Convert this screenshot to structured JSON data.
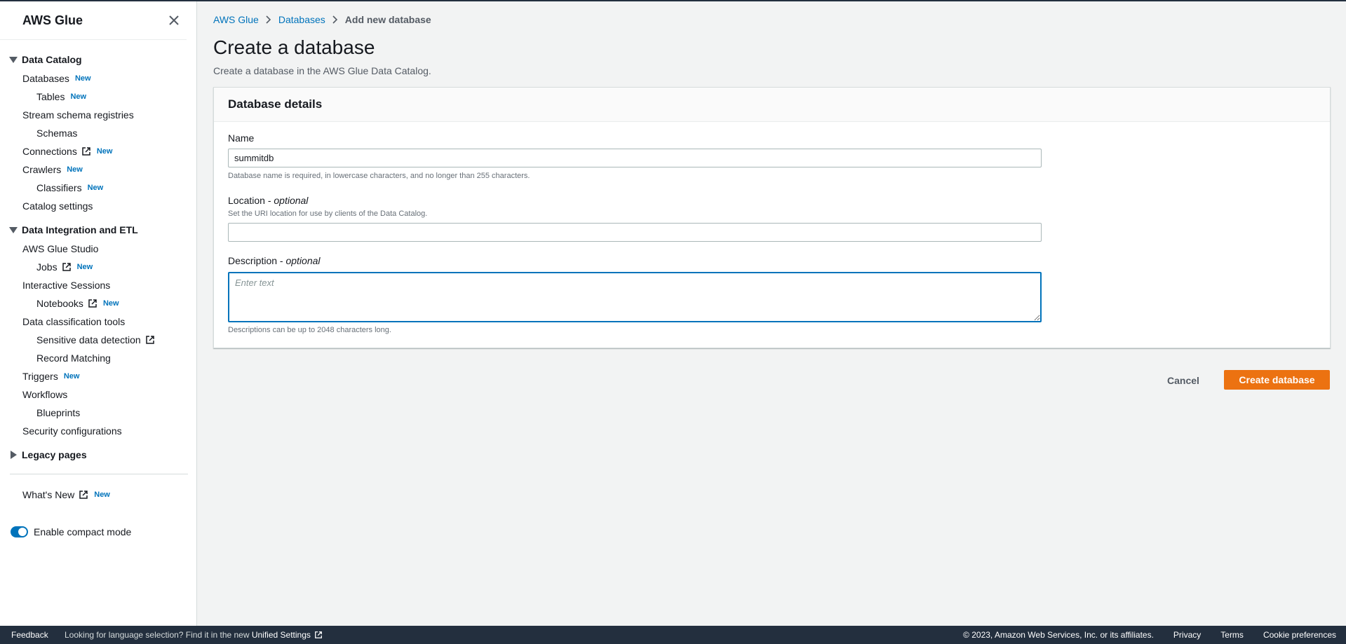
{
  "sidebar": {
    "title": "AWS Glue",
    "sections": {
      "data_catalog": "Data Catalog",
      "data_integration": "Data Integration and ETL",
      "legacy": "Legacy pages"
    },
    "items": {
      "databases": "Databases",
      "tables": "Tables",
      "stream_schema_registries": "Stream schema registries",
      "schemas": "Schemas",
      "connections": "Connections",
      "crawlers": "Crawlers",
      "classifiers": "Classifiers",
      "catalog_settings": "Catalog settings",
      "glue_studio": "AWS Glue Studio",
      "jobs": "Jobs",
      "interactive_sessions": "Interactive Sessions",
      "notebooks": "Notebooks",
      "data_classification": "Data classification tools",
      "sensitive_data": "Sensitive data detection",
      "record_matching": "Record Matching",
      "triggers": "Triggers",
      "workflows": "Workflows",
      "blueprints": "Blueprints",
      "security_configurations": "Security configurations",
      "whats_new": "What's New"
    },
    "badge_new": "New",
    "compact_mode_label": "Enable compact mode",
    "compact_mode_on": true
  },
  "breadcrumb": {
    "root": "AWS Glue",
    "databases": "Databases",
    "current": "Add new database"
  },
  "page": {
    "title": "Create a database",
    "subtitle": "Create a database in the AWS Glue Data Catalog."
  },
  "panel": {
    "title": "Database details",
    "name_label": "Name",
    "name_value": "summitdb",
    "name_hint": "Database name is required, in lowercase characters, and no longer than 255 characters.",
    "location_label": "Location - ",
    "location_optional": "optional",
    "location_hint": "Set the URI location for use by clients of the Data Catalog.",
    "location_value": "",
    "description_label": "Description - ",
    "description_optional": "optional",
    "description_placeholder": "Enter text",
    "description_hint": "Descriptions can be up to 2048 characters long."
  },
  "actions": {
    "cancel": "Cancel",
    "create": "Create database"
  },
  "footer": {
    "feedback": "Feedback",
    "language_msg": "Looking for language selection? Find it in the new ",
    "unified_settings": "Unified Settings",
    "copyright": "© 2023, Amazon Web Services, Inc. or its affiliates.",
    "privacy": "Privacy",
    "terms": "Terms",
    "cookie_prefs": "Cookie preferences"
  },
  "colors": {
    "accent": "#0073bb",
    "primary_button": "#ec7211",
    "footer_bg": "#232f3e"
  }
}
